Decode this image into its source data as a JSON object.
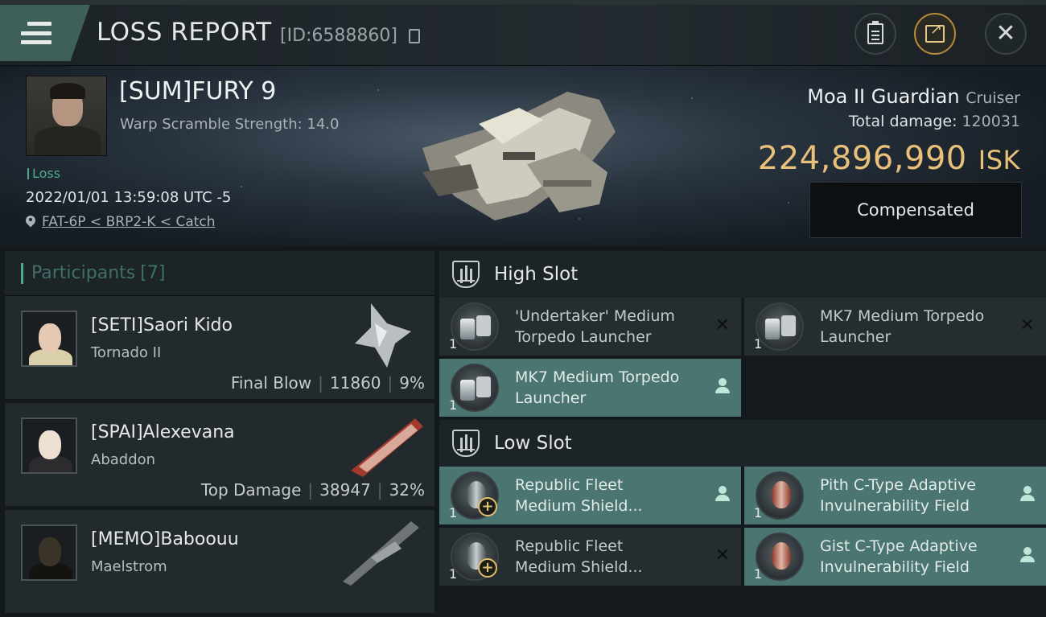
{
  "header": {
    "title": "LOSS REPORT",
    "report_id": "[ID:6588860]"
  },
  "victim": {
    "pilot_name": "[SUM]FURY 9",
    "warp_scramble": "Warp Scramble Strength: 14.0",
    "result_tag": "Loss",
    "datetime": "2022/01/01 13:59:08 UTC -5",
    "location": "FAT-6P < BRP2-K < Catch",
    "ship_name": "Moa II Guardian",
    "ship_class": "Cruiser",
    "total_damage_label": "Total damage:",
    "total_damage": "120031",
    "isk_value": "224,896,990",
    "isk_unit": "ISK",
    "compensated_label": "Compensated"
  },
  "participants": {
    "label": "Participants",
    "count": "[7]",
    "items": [
      {
        "name": "[SETI]Saori Kido",
        "ship": "Tornado II",
        "role": "Final Blow",
        "damage": "11860",
        "percent": "9%",
        "face": "#e6c9b2",
        "body": "#d9cfa8"
      },
      {
        "name": "[SPAI]Alexevana",
        "ship": "Abaddon",
        "role": "Top Damage",
        "damage": "38947",
        "percent": "32%",
        "face": "#eedfd3",
        "body": "#2c2c2e"
      },
      {
        "name": "[MEMO]Baboouu",
        "ship": "Maelstrom",
        "role": "",
        "damage": "",
        "percent": "",
        "face": "#3a3328",
        "body": "#15130f"
      }
    ]
  },
  "high_slot": {
    "label": "High Slot",
    "items": [
      {
        "name": "'Undertaker' Medium Torpedo Launcher",
        "line1": "'Undertaker' Medium",
        "line2": "Torpedo Launcher",
        "qty": "1",
        "status": "destroyed"
      },
      {
        "name": "MK7 Medium Torpedo Launcher",
        "line1": "MK7 Medium Torpedo",
        "line2": " Launcher",
        "qty": "1",
        "status": "destroyed"
      },
      {
        "name": "MK7 Medium Torpedo Launcher",
        "line1": "MK7 Medium Torpedo",
        "line2": " Launcher",
        "qty": "1",
        "status": "dropped"
      }
    ]
  },
  "low_slot": {
    "label": "Low Slot",
    "items": [
      {
        "line1": "Republic Fleet",
        "line2": "Medium Shield...",
        "qty": "1",
        "status": "dropped"
      },
      {
        "line1": "Pith C-Type Adaptive",
        "line2": "Invulnerability Field",
        "qty": "1",
        "status": "dropped"
      },
      {
        "line1": "Republic Fleet",
        "line2": "Medium Shield...",
        "qty": "1",
        "status": "destroyed"
      },
      {
        "line1": "Gist C-Type Adaptive",
        "line2": "Invulnerability Field",
        "qty": "1",
        "status": "dropped"
      }
    ]
  },
  "colors": {
    "accent_teal": "#4b7571",
    "isk_gold": "#e8c07a",
    "loss_green": "#4fa88f"
  }
}
